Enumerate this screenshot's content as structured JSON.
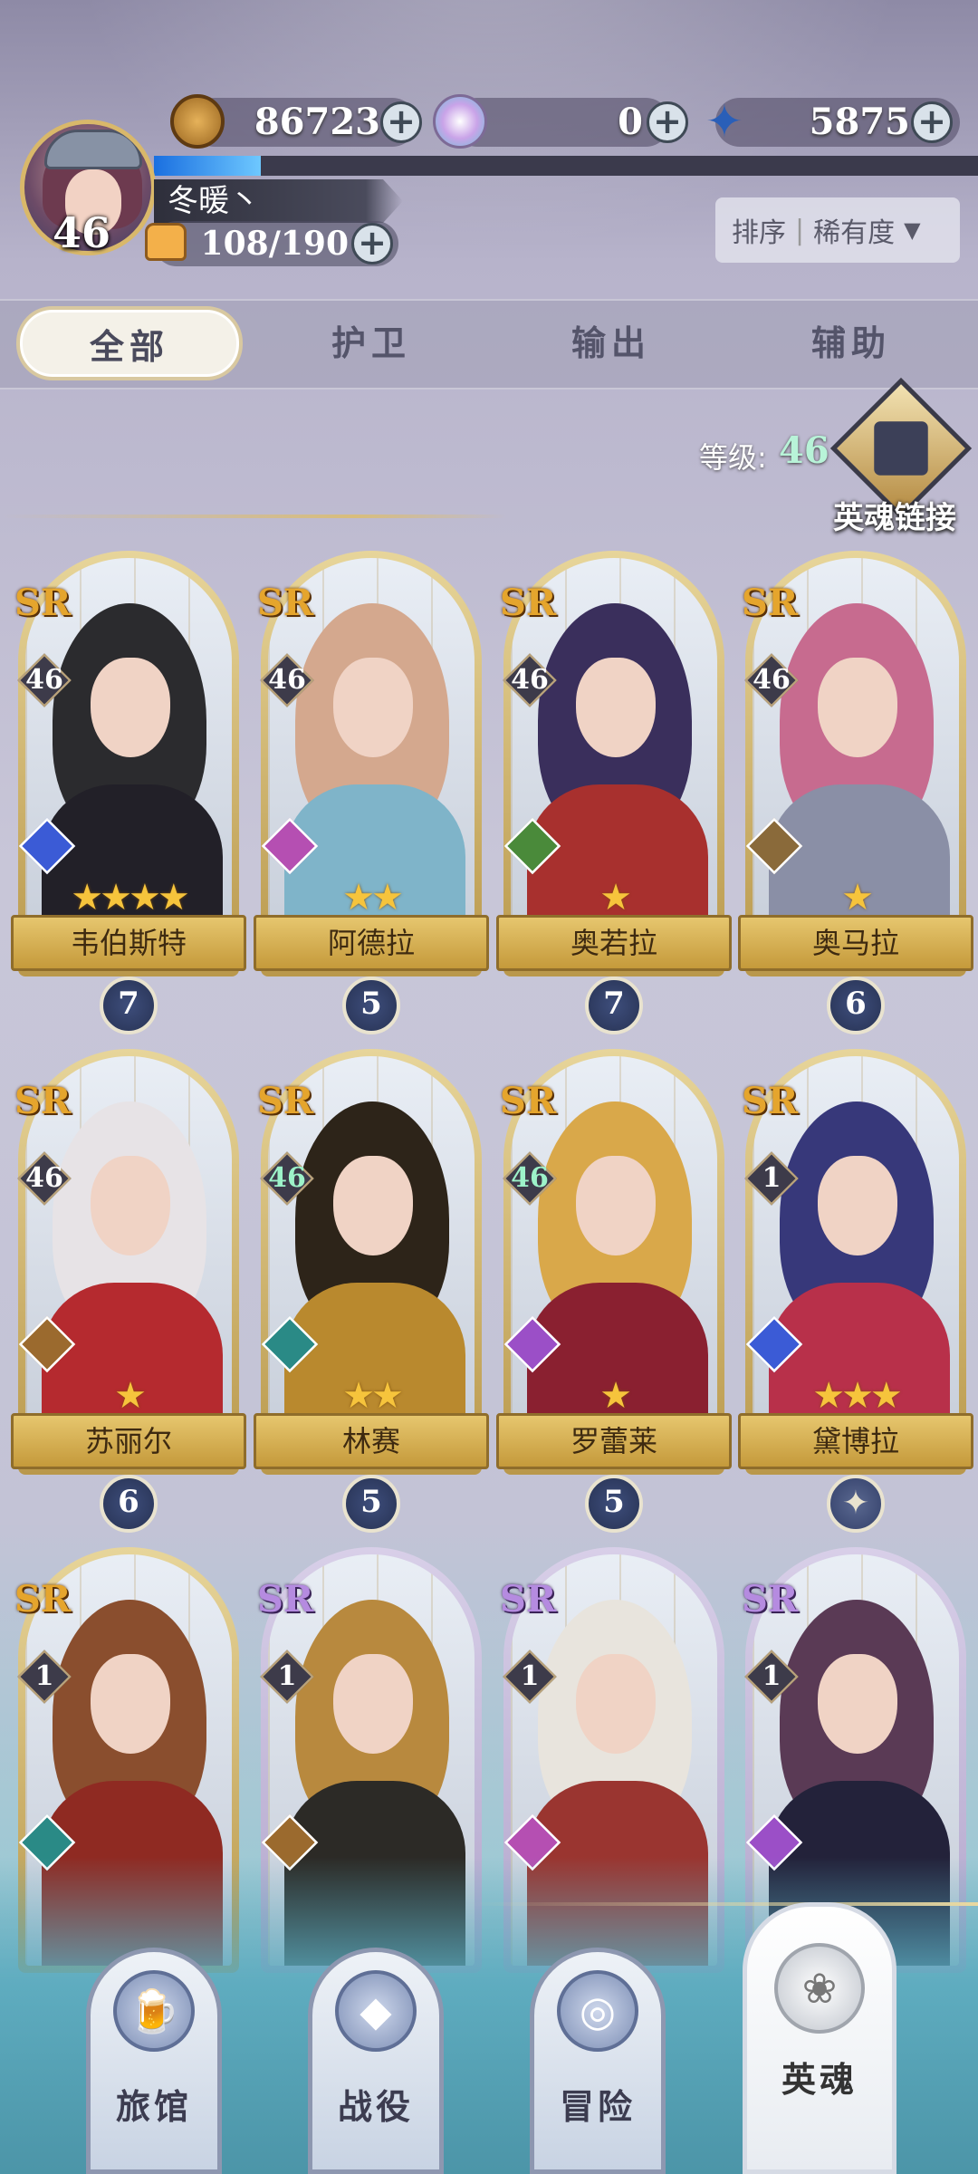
{
  "resources": {
    "gold": {
      "icon": "coin-icon",
      "value": "86723"
    },
    "gem": {
      "icon": "gem-icon",
      "value": "0"
    },
    "crystal": {
      "icon": "star-crystal-icon",
      "value": "5875"
    }
  },
  "player": {
    "level": "46",
    "name": "冬暖丶",
    "stamina": "108/190",
    "xp_progress": 0.13
  },
  "sort": {
    "label": "排序",
    "value": "稀有度"
  },
  "tabs": [
    {
      "label": "全部",
      "active": true
    },
    {
      "label": "护卫",
      "active": false
    },
    {
      "label": "输出",
      "active": false
    },
    {
      "label": "辅助",
      "active": false
    }
  ],
  "hero_level": {
    "label": "等级:",
    "value": "46"
  },
  "hero_link": {
    "label": "英魂链接"
  },
  "heroes": [
    {
      "name": "韦伯斯特",
      "rarity": "SR",
      "rarity_tier": "gold",
      "level": "46",
      "stars": "★★★★",
      "count": "7",
      "class_color": "#3b5bd6",
      "hair": "#2b2b2e",
      "body": "#222028"
    },
    {
      "name": "阿德拉",
      "rarity": "SR",
      "rarity_tier": "gold",
      "level": "46",
      "stars": "★★",
      "count": "5",
      "class_color": "#b54fb2",
      "hair": "#d4a88e",
      "body": "#7fb4c9"
    },
    {
      "name": "奥若拉",
      "rarity": "SR",
      "rarity_tier": "gold",
      "level": "46",
      "stars": "★",
      "count": "7",
      "class_color": "#4a8a3a",
      "hair": "#3a2f5c",
      "body": "#a8302e"
    },
    {
      "name": "奥马拉",
      "rarity": "SR",
      "rarity_tier": "gold",
      "level": "46",
      "stars": "★",
      "count": "6",
      "class_color": "#8a6a3a",
      "hair": "#c76b8f",
      "body": "#8a8fa6"
    },
    {
      "name": "苏丽尔",
      "rarity": "SR",
      "rarity_tier": "gold",
      "level": "46",
      "stars": "★",
      "count": "6",
      "class_color": "#9b6a2e",
      "hair": "#e7e3e6",
      "body": "#b52a2f"
    },
    {
      "name": "林赛",
      "rarity": "SR",
      "rarity_tier": "gold",
      "level": "46",
      "stars": "★★",
      "count": "5",
      "class_color": "#2a8a86",
      "hair": "#2d2419",
      "body": "#b9892e"
    },
    {
      "name": "罗蕾莱",
      "rarity": "SR",
      "rarity_tier": "gold",
      "level": "46",
      "stars": "★",
      "count": "5",
      "class_color": "#9b4fc7",
      "hair": "#d9a84a",
      "body": "#8a2030"
    },
    {
      "name": "黛博拉",
      "rarity": "SR",
      "rarity_tier": "gold",
      "level": "1",
      "stars": "★★★",
      "count": "",
      "class_color": "#3b5bd6",
      "hair": "#37387a",
      "body": "#b8304a"
    },
    {
      "name": "",
      "rarity": "SR",
      "rarity_tier": "gold",
      "level": "1",
      "stars": "",
      "count": "",
      "class_color": "#2a8a86",
      "hair": "#8a4e2e",
      "body": "#8f2a22"
    },
    {
      "name": "",
      "rarity": "SR",
      "rarity_tier": "purple",
      "level": "1",
      "stars": "",
      "count": "",
      "class_color": "#9b6a2e",
      "hair": "#b8893e",
      "body": "#2c2a26"
    },
    {
      "name": "",
      "rarity": "SR",
      "rarity_tier": "purple",
      "level": "1",
      "stars": "",
      "count": "",
      "class_color": "#b54fb2",
      "hair": "#e8e4dd",
      "body": "#9a3530"
    },
    {
      "name": "",
      "rarity": "SR",
      "rarity_tier": "purple",
      "level": "1",
      "stars": "",
      "count": "",
      "class_color": "#9b4fc7",
      "hair": "#5a3a55",
      "body": "#23223a"
    }
  ],
  "bottom_nav": [
    {
      "label": "旅馆",
      "icon": "tavern-mug-icon",
      "active": false
    },
    {
      "label": "战役",
      "icon": "campaign-banner-icon",
      "active": false
    },
    {
      "label": "冒险",
      "icon": "adventure-swirl-icon",
      "active": false
    },
    {
      "label": "英魂",
      "icon": "hero-rose-icon",
      "active": true
    }
  ]
}
